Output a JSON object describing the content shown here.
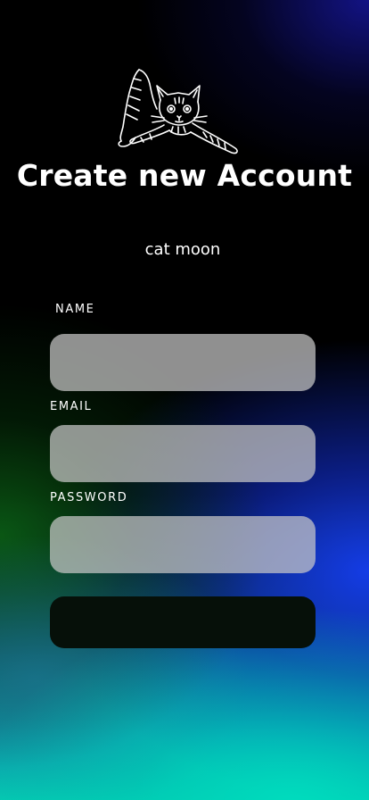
{
  "header": {
    "title": "Create new Account",
    "subtitle": "cat moon",
    "logo_icon": "cat-logo-icon"
  },
  "form": {
    "name_label": "NAME",
    "name_value": "",
    "email_label": "EMAIL",
    "email_value": "",
    "password_label": "PASSWORD",
    "password_value": "",
    "submit_label": ""
  },
  "colors": {
    "field_background": "#c8c8c8",
    "button_background": "#061009",
    "text": "#ffffff"
  }
}
